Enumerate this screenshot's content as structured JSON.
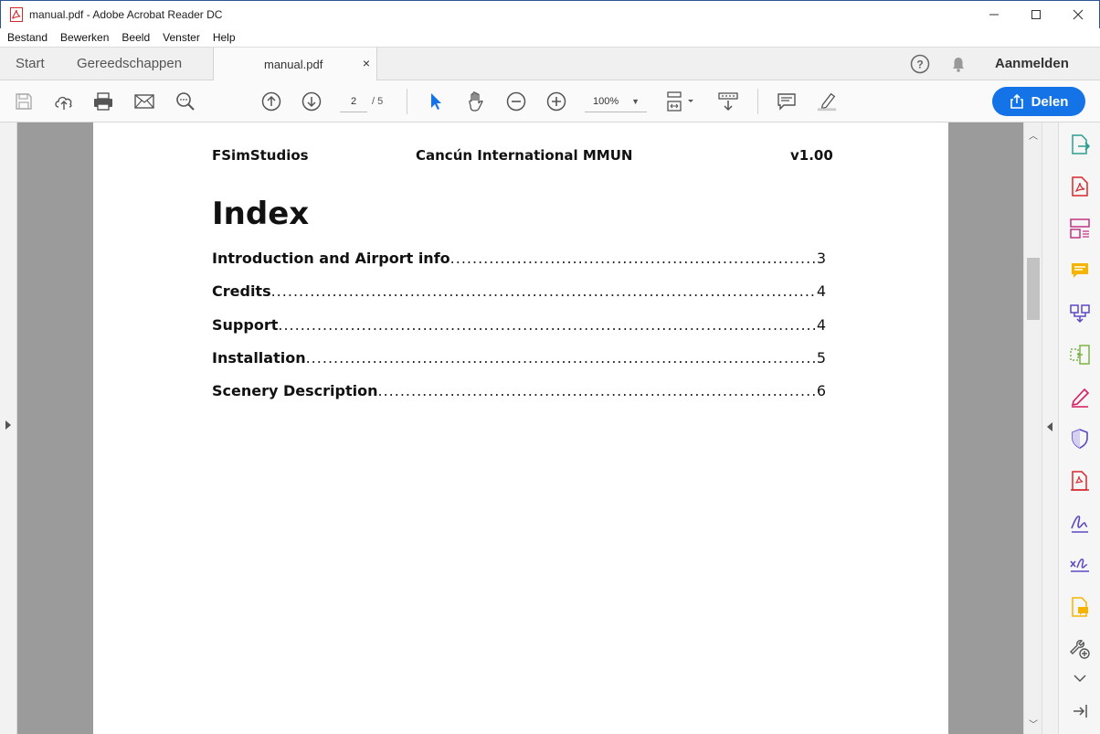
{
  "window": {
    "title": "manual.pdf - Adobe Acrobat Reader DC",
    "controls": [
      "minimize-icon",
      "maximize-icon",
      "close-icon"
    ]
  },
  "menu": [
    "Bestand",
    "Bewerken",
    "Beeld",
    "Venster",
    "Help"
  ],
  "tabs": {
    "start": "Start",
    "tools": "Gereedschappen",
    "document": "manual.pdf",
    "close": "×"
  },
  "account": {
    "signin": "Aanmelden"
  },
  "toolbar": {
    "current_page": "2",
    "total_pages": "/  5",
    "zoom": "100%",
    "share_label": "Delen",
    "accent": "#1473e6"
  },
  "document": {
    "header_left": "FSimStudios",
    "header_center": "Cancún International MMUN",
    "header_right": "v1.00",
    "title": "Index",
    "toc": [
      {
        "title": "Introduction and Airport info",
        "page": "3"
      },
      {
        "title": "Credits",
        "page": "4"
      },
      {
        "title": "Support",
        "page": "4"
      },
      {
        "title": "Installation",
        "page": "5"
      },
      {
        "title": "Scenery Description",
        "page": "6"
      }
    ]
  },
  "right_panel_icons": [
    "export-pdf-icon",
    "create-pdf-icon",
    "organize-pages-icon",
    "comment-icon",
    "combine-files-icon",
    "compress-pdf-icon",
    "fill-sign-icon",
    "protect-icon",
    "redact-icon",
    "sign-icon",
    "request-signature-icon",
    "send-review-icon",
    "more-tools-icon",
    "expand-icon",
    "collapse-panel-icon"
  ]
}
